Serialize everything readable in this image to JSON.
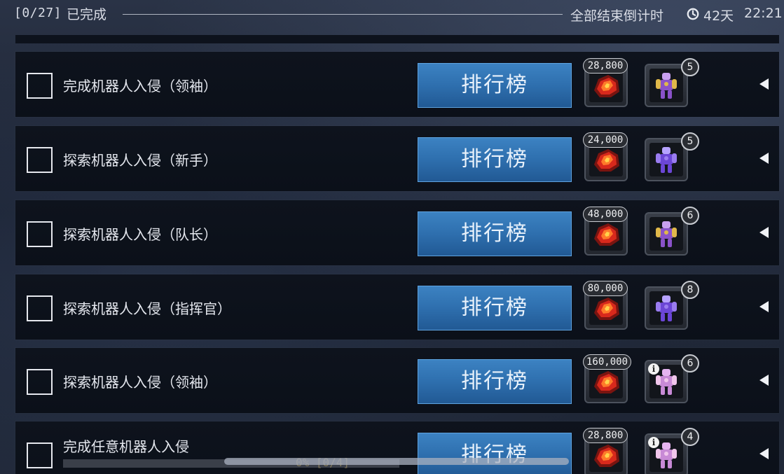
{
  "header": {
    "count": "[0/27]",
    "done_label": "已完成",
    "countdown_label": "全部结束倒计时",
    "days": "42天",
    "time": "22:21"
  },
  "rank_button_label": "排行榜",
  "tasks": [
    {
      "title": "完成机器人入侵（领袖）",
      "amount": "28,800",
      "qty": "5",
      "robot": "gold",
      "info": false
    },
    {
      "title": "探索机器人入侵（新手）",
      "amount": "24,000",
      "qty": "5",
      "robot": "purple",
      "info": false
    },
    {
      "title": "探索机器人入侵（队长）",
      "amount": "48,000",
      "qty": "6",
      "robot": "gold",
      "info": false
    },
    {
      "title": "探索机器人入侵（指挥官）",
      "amount": "80,000",
      "qty": "8",
      "robot": "purple",
      "info": false
    },
    {
      "title": "探索机器人入侵（领袖）",
      "amount": "160,000",
      "qty": "6",
      "robot": "pink",
      "info": true
    },
    {
      "title": "完成任意机器人入侵",
      "amount": "28,800",
      "qty": "4",
      "robot": "pink",
      "info": true,
      "progress_text": "0%  [0/4]",
      "progress": 0
    }
  ],
  "icons": {
    "clock": "clock-icon",
    "ore": "red-crystal-ore-icon",
    "robot": "robot-figure-icon",
    "info": "info-icon",
    "arrow": "collapse-arrow-left-icon"
  },
  "colors": {
    "button_blue": "#2e6fae",
    "row_bg": "#0e131d",
    "ore_red": "#d8291c"
  }
}
